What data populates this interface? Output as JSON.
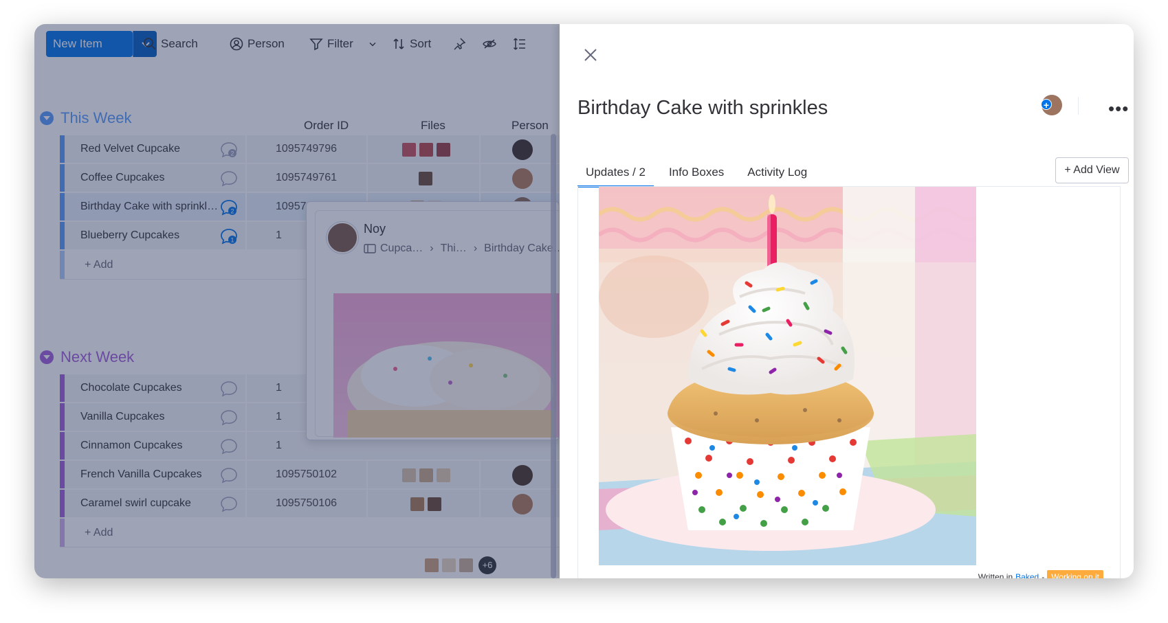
{
  "toolbar": {
    "new_item": "New Item",
    "search": "Search",
    "person": "Person",
    "filter": "Filter",
    "sort": "Sort"
  },
  "columns": {
    "order_id": "Order ID",
    "files": "Files",
    "person": "Person"
  },
  "groups": [
    {
      "title": "This Week",
      "color": "#579bfc",
      "items": [
        {
          "name": "Red Velvet Cupcake",
          "order_id": "1095749796",
          "updates": "2"
        },
        {
          "name": "Coffee Cupcakes",
          "order_id": "1095749761",
          "updates": ""
        },
        {
          "name": "Birthday Cake with sprinkl…",
          "order_id": "1095749914",
          "updates": "2"
        },
        {
          "name": "Blueberry Cupcakes",
          "order_id": "1",
          "updates": "1"
        }
      ],
      "add_label": "+ Add"
    },
    {
      "title": "Next Week",
      "color": "#a25ddc",
      "items": [
        {
          "name": "Chocolate Cupcakes",
          "order_id": "1",
          "updates": ""
        },
        {
          "name": "Vanilla Cupcakes",
          "order_id": "1",
          "updates": ""
        },
        {
          "name": "Cinnamon Cupcakes",
          "order_id": "1",
          "updates": ""
        },
        {
          "name": "French Vanilla Cupcakes",
          "order_id": "1095750102",
          "updates": ""
        },
        {
          "name": "Caramel swirl cupcake",
          "order_id": "1095750106",
          "updates": ""
        }
      ],
      "add_label": "+ Add"
    }
  ],
  "hover_card": {
    "name": "Noy",
    "crumbs": [
      "Cupca…",
      "Thi…",
      "Birthday Cake…"
    ]
  },
  "bottom": {
    "more_count": "+6"
  },
  "panel": {
    "title": "Birthday Cake with sprinkles",
    "more": "•••",
    "plus": "+",
    "tabs": [
      "Updates / 2",
      "Info Boxes",
      "Activity Log"
    ],
    "add_view": "+ Add View",
    "written_in": "Written in",
    "board_link": "Baked",
    "dash": "-",
    "status": "Working on it"
  },
  "colors": {
    "primary": "#0073ea",
    "status_working": "#fdab3d",
    "this_week": "#579bfc",
    "next_week": "#a25ddc"
  }
}
